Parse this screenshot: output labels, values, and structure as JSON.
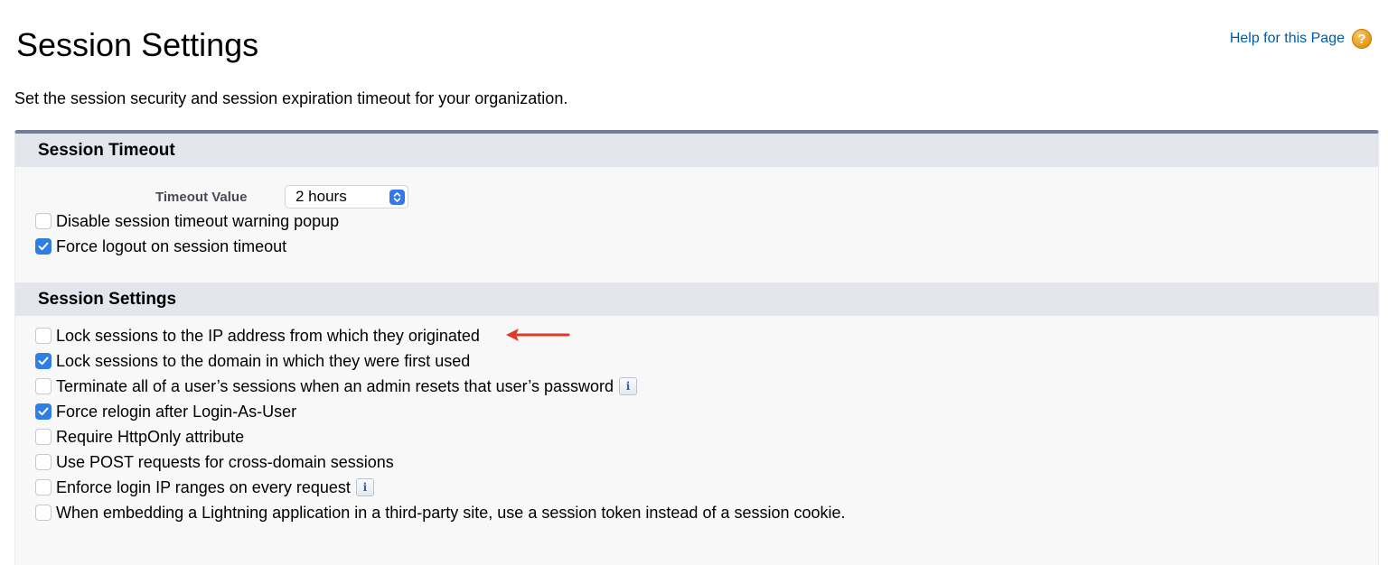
{
  "page": {
    "title": "Session Settings",
    "help_link": "Help for this Page",
    "help_icon": "help-icon",
    "description": "Set the session security and session expiration timeout for your organization."
  },
  "colors": {
    "panel_top_border": "#747e96",
    "section_header_bg": "#e3e6ed",
    "checkbox_checked": "#2f7ee3",
    "help_link": "#015ba7",
    "annotation_arrow": "#e03a2c"
  },
  "session_timeout": {
    "heading": "Session Timeout",
    "timeout_label": "Timeout Value",
    "timeout_value": "2 hours",
    "options": [
      {
        "label": "Disable session timeout warning popup",
        "checked": false
      },
      {
        "label": "Force logout on session timeout",
        "checked": true
      }
    ]
  },
  "session_settings": {
    "heading": "Session Settings",
    "options": [
      {
        "label": "Lock sessions to the IP address from which they originated",
        "checked": false,
        "info": false
      },
      {
        "label": "Lock sessions to the domain in which they were first used",
        "checked": true,
        "info": false
      },
      {
        "label": "Terminate all of a user’s sessions when an admin resets that user’s password",
        "checked": false,
        "info": true
      },
      {
        "label": "Force relogin after Login-As-User",
        "checked": true,
        "info": false
      },
      {
        "label": "Require HttpOnly attribute",
        "checked": false,
        "info": false
      },
      {
        "label": "Use POST requests for cross-domain sessions",
        "checked": false,
        "info": false
      },
      {
        "label": "Enforce login IP ranges on every request",
        "checked": false,
        "info": true
      },
      {
        "label": "When embedding a Lightning application in a third-party site, use a session token instead of a session cookie.",
        "checked": false,
        "info": false
      }
    ],
    "info_glyph": "i"
  }
}
